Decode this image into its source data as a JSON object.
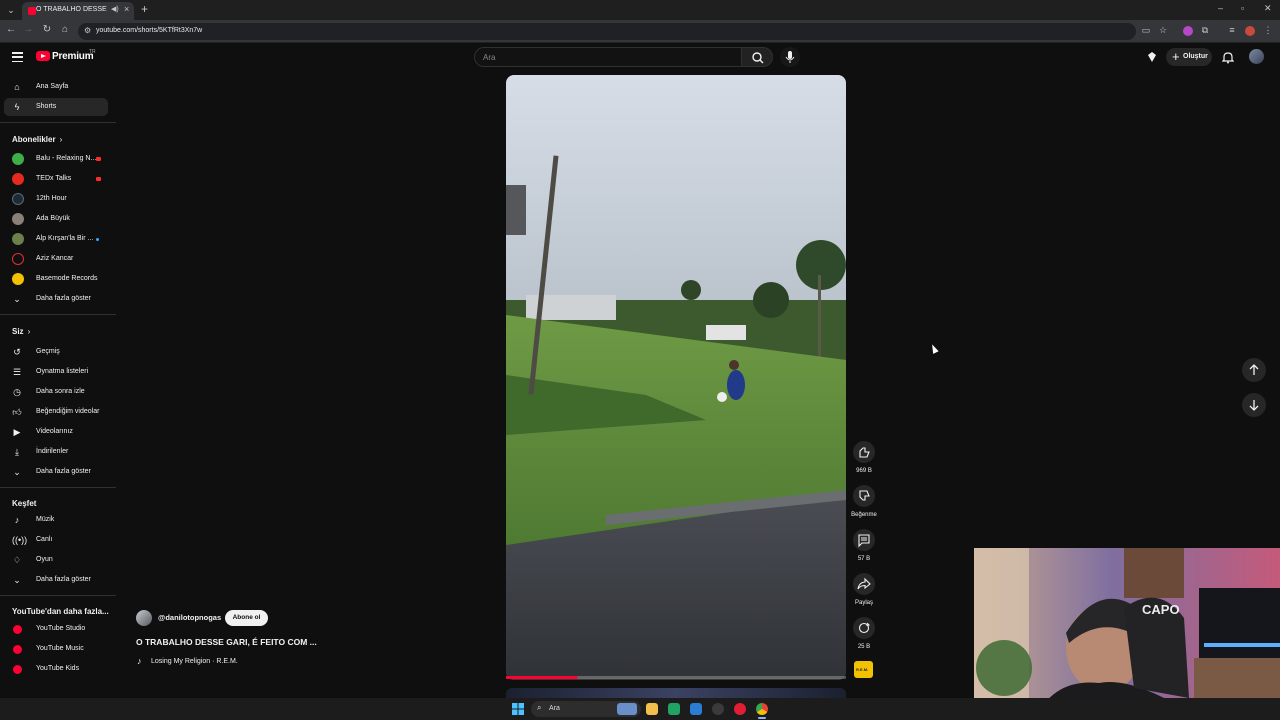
{
  "browser": {
    "tab_title": "O TRABALHO DESSE GARI,",
    "tab_audio_icon": "speaker-icon",
    "url": "youtube.com/shorts/5KTfRt3Xn7w"
  },
  "header": {
    "logo_text": "Premium",
    "logo_country": "TR",
    "search_placeholder": "Ara",
    "create_label": "Oluştur"
  },
  "sidebar": {
    "main": [
      {
        "label": "Ana Sayfa",
        "icon": "home-icon"
      },
      {
        "label": "Shorts",
        "icon": "shorts-icon",
        "active": true
      }
    ],
    "subscriptions_title": "Abonelikler",
    "subscriptions": [
      {
        "label": "Balu - Relaxing N...",
        "live": true
      },
      {
        "label": "TEDx Talks",
        "live": true
      },
      {
        "label": "12th Hour"
      },
      {
        "label": "Ada Büyük"
      },
      {
        "label": "Alp Kırşan'la Bir ...",
        "new": true
      },
      {
        "label": "Aziz Kancar"
      },
      {
        "label": "Basemode Records"
      }
    ],
    "subscriptions_more": "Daha fazla göster",
    "you_title": "Siz",
    "you": [
      {
        "label": "Geçmiş",
        "icon": "history-icon"
      },
      {
        "label": "Oynatma listeleri",
        "icon": "playlist-icon"
      },
      {
        "label": "Daha sonra izle",
        "icon": "clock-icon"
      },
      {
        "label": "Beğendiğim videolar",
        "icon": "thumb-up-icon"
      },
      {
        "label": "Videolarınız",
        "icon": "video-icon"
      },
      {
        "label": "İndirilenler",
        "icon": "download-icon"
      }
    ],
    "you_more": "Daha fazla göster",
    "explore_title": "Keşfet",
    "explore": [
      {
        "label": "Müzik",
        "icon": "music-icon"
      },
      {
        "label": "Canlı",
        "icon": "live-icon"
      },
      {
        "label": "Oyun",
        "icon": "gaming-icon"
      }
    ],
    "explore_more": "Daha fazla göster",
    "more_title": "YouTube'dan daha fazla...",
    "more": [
      {
        "label": "YouTube Studio"
      },
      {
        "label": "YouTube Music"
      },
      {
        "label": "YouTube Kids"
      }
    ]
  },
  "short": {
    "channel": "@danilotopnogas",
    "subscribe_label": "Abone ol",
    "title": "O TRABALHO DESSE GARI, É FEITO COM ...",
    "music": "Losing My Religion · R.E.M.",
    "progress": 0.21,
    "actions": {
      "like_count": "969 B",
      "dislike_label": "Beğenme",
      "comment_count": "57 B",
      "share_label": "Paylaş",
      "remix_count": "25 B"
    },
    "sound_thumb_text": "R.E.M."
  },
  "taskbar": {
    "search_placeholder": "Ara"
  },
  "colors": {
    "background": "#0f0f0f",
    "brand_red": "#ff0033",
    "surface": "#272727"
  }
}
